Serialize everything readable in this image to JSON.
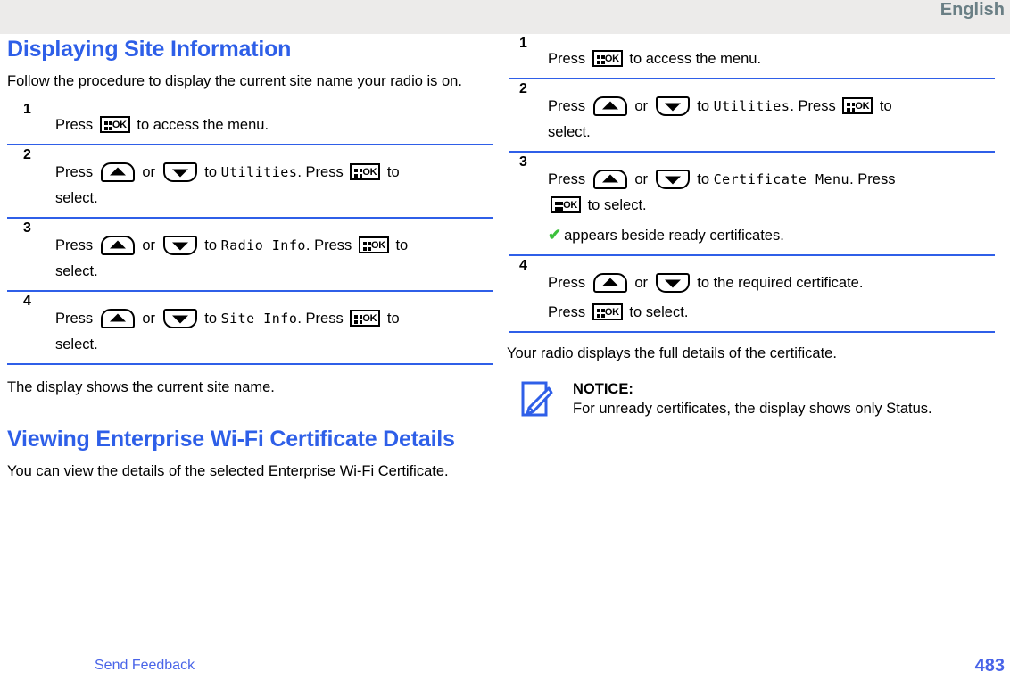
{
  "header": {
    "language": "English"
  },
  "left_column": {
    "heading": "Displaying Site Information",
    "intro": "Follow the procedure to display the current site name your radio is on.",
    "steps": [
      {
        "num": "1",
        "pre": "Press",
        "mid": "to access the menu.",
        "icons": [
          "ok-key-icon"
        ]
      },
      {
        "num": "2",
        "pre": "Press",
        "or": "or",
        "to": "to",
        "menu": "Utilities",
        "press2": ". Press",
        "post": "to",
        "sub": "select."
      },
      {
        "num": "3",
        "pre": "Press",
        "or": "or",
        "to": "to",
        "menu": "Radio Info",
        "press2": ". Press",
        "post": "to",
        "sub": "select."
      },
      {
        "num": "4",
        "pre": "Press",
        "or": "or",
        "to": "to",
        "menu": "Site Info",
        "press2": ". Press",
        "post": "to",
        "sub": "select."
      }
    ],
    "result": "The display shows the current site name.",
    "heading2": "Viewing Enterprise Wi-Fi Certificate Details",
    "intro2": "You can view the details of the selected Enterprise Wi-Fi Certificate."
  },
  "right_column": {
    "steps": [
      {
        "num": "1",
        "pre": "Press",
        "mid": "to access the menu."
      },
      {
        "num": "2",
        "pre": "Press",
        "or": "or",
        "to": "to",
        "menu": "Utilities",
        "press2": ". Press",
        "post": "to",
        "sub": "select."
      },
      {
        "num": "3",
        "pre": "Press",
        "or": "or",
        "to": "to",
        "menu": "Certificate Menu",
        "press2": ". Press",
        "post": "to select.",
        "check_note": "appears beside ready certificates.",
        "check_glyph": "✔"
      },
      {
        "num": "4",
        "pre": "Press",
        "or": "or",
        "to": "to the required certificate.",
        "sub_pre": "Press",
        "sub_post": "to select."
      }
    ],
    "result": "Your radio displays the full details of the certificate.",
    "notice": {
      "title": "NOTICE:",
      "text": "For unready certificates, the display shows only Status.",
      "icon": "note-pencil-icon"
    }
  },
  "footer": {
    "send_feedback": "Send Feedback",
    "page_number": "483"
  },
  "colors": {
    "heading_blue": "#2e5fe8",
    "rule_blue": "#2f5fe8",
    "header_band": "#ecebea",
    "header_text": "#6a7f85",
    "link_blue": "#4964e8",
    "check_green": "#3cc13c"
  }
}
